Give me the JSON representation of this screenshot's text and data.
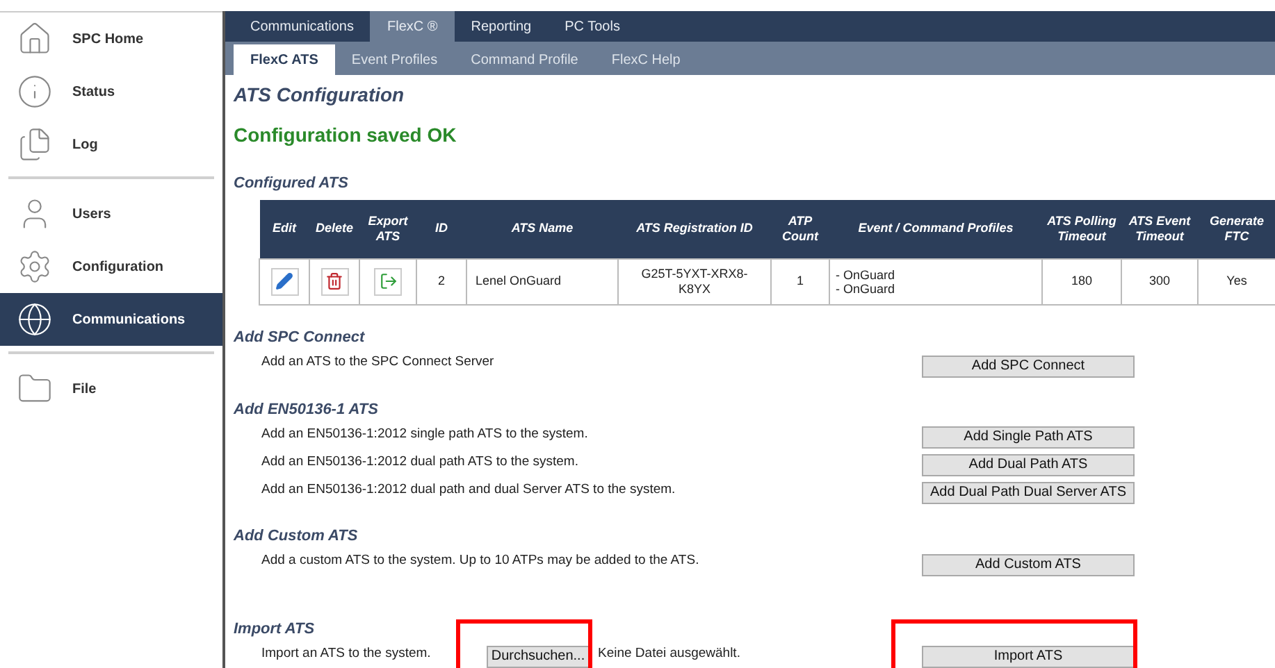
{
  "sidebar": {
    "groups": [
      [
        {
          "label": "SPC Home",
          "selected": false
        },
        {
          "label": "Status",
          "selected": false
        },
        {
          "label": "Log",
          "selected": false
        }
      ],
      [
        {
          "label": "Users",
          "selected": false
        },
        {
          "label": "Configuration",
          "selected": false
        },
        {
          "label": "Communications",
          "selected": true
        }
      ],
      [
        {
          "label": "File",
          "selected": false
        }
      ]
    ]
  },
  "tabs": [
    {
      "label": "Communications",
      "selected": false
    },
    {
      "label": "FlexC ®",
      "selected": true
    },
    {
      "label": "Reporting",
      "selected": false
    },
    {
      "label": "PC Tools",
      "selected": false
    }
  ],
  "subtabs": [
    {
      "label": "FlexC ATS",
      "selected": true
    },
    {
      "label": "Event Profiles",
      "selected": false
    },
    {
      "label": "Command Profile",
      "selected": false
    },
    {
      "label": "FlexC Help",
      "selected": false
    }
  ],
  "page_title": "ATS Configuration",
  "status_message": "Configuration saved OK",
  "configured": {
    "title": "Configured ATS",
    "columns": [
      "Edit",
      "Delete",
      "Export ATS",
      "ID",
      "ATS Name",
      "ATS Registration ID",
      "ATP Count",
      "Event / Command Profiles",
      "ATS Polling Timeout",
      "ATS Event Timeout",
      "Generate FTC"
    ],
    "rows": [
      {
        "id": "2",
        "name": "Lenel OnGuard",
        "registration_id": "G25T-5YXT-XRX8-K8YX",
        "atp_count": "1",
        "profiles": [
          "- OnGuard",
          "- OnGuard"
        ],
        "polling_timeout": "180",
        "event_timeout": "300",
        "generate_ftc": "Yes"
      }
    ]
  },
  "sections": [
    {
      "title": "Add SPC Connect",
      "rows": [
        {
          "text": "Add an ATS to the SPC Connect Server",
          "button": "Add SPC Connect"
        }
      ]
    },
    {
      "title": "Add EN50136-1 ATS",
      "rows": [
        {
          "text": "Add an EN50136-1:2012 single path ATS to the system.",
          "button": "Add Single Path ATS"
        },
        {
          "text": "Add an EN50136-1:2012 dual path ATS to the system.",
          "button": "Add Dual Path ATS"
        },
        {
          "text": "Add an EN50136-1:2012 dual path and dual Server ATS to the system.",
          "button": "Add Dual Path Dual Server ATS"
        }
      ]
    },
    {
      "title": "Add Custom ATS",
      "rows": [
        {
          "text": "Add a custom ATS to the system. Up to 10 ATPs may be added to the ATS.",
          "button": "Add Custom ATS"
        }
      ]
    }
  ],
  "import": {
    "title": "Import ATS",
    "text": "Import an ATS to the system.",
    "browse_button": {
      "label": "Durchsuchen...",
      "highlighted": true
    },
    "file_status": "Keine Datei ausgewählt.",
    "import_button": {
      "label": "Import ATS",
      "highlighted": true
    }
  }
}
